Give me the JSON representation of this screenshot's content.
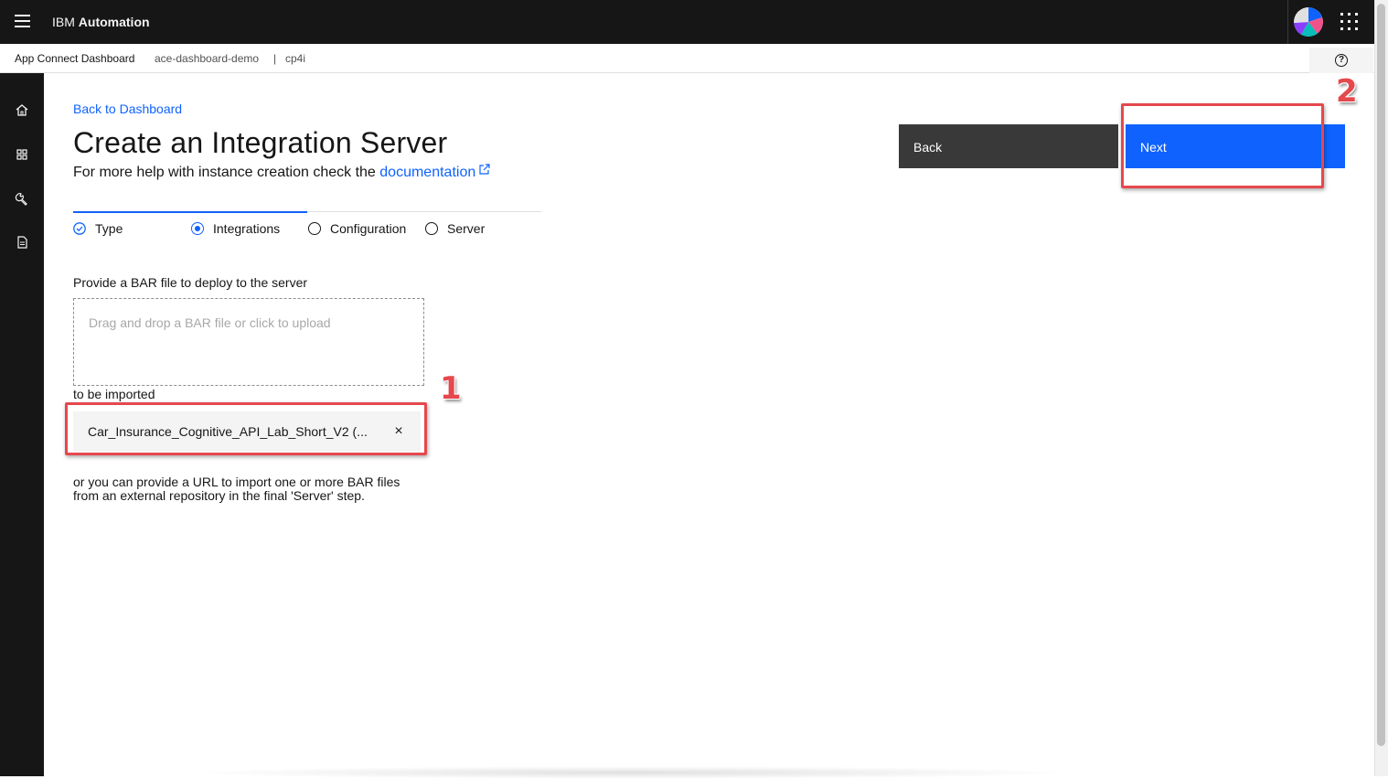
{
  "header": {
    "brand_prefix": "IBM",
    "brand_name": "Automation",
    "menu_icon": "hamburger-menu-icon",
    "avatar_icon": "user-avatar-icon",
    "switcher_icon": "app-switcher-icon"
  },
  "subheader": {
    "app_name": "App Connect Dashboard",
    "instance": "ace-dashboard-demo",
    "separator": "|",
    "namespace": "cp4i",
    "help_icon": "help-icon"
  },
  "sidenav": {
    "items": [
      {
        "icon": "home-icon"
      },
      {
        "icon": "dashboard-icon"
      },
      {
        "icon": "tools-icon"
      },
      {
        "icon": "document-icon"
      }
    ]
  },
  "page": {
    "back_link": "Back to Dashboard",
    "title": "Create an Integration Server",
    "subtitle_prefix": "For more help with instance creation check the",
    "doc_link": "documentation"
  },
  "actions": {
    "back_label": "Back",
    "next_label": "Next"
  },
  "steps": [
    {
      "label": "Type",
      "state": "complete"
    },
    {
      "label": "Integrations",
      "state": "current"
    },
    {
      "label": "Configuration",
      "state": "incomplete"
    },
    {
      "label": "Server",
      "state": "incomplete"
    }
  ],
  "upload": {
    "label": "Provide a BAR file to deploy to the server",
    "dropzone_text": "Drag and drop a BAR file or click to upload",
    "imported_label": "to be imported",
    "file_name": "Car_Insurance_Cognitive_API_Lab_Short_V2 (...",
    "remove_glyph": "×",
    "url_note_line1": "or you can provide a URL to import one or more BAR files",
    "url_note_line2": "from an external repository in the final 'Server' step."
  },
  "callouts": {
    "first": "1",
    "second": "2",
    "color": "#e5484d"
  },
  "colors": {
    "primary": "#0f62fe",
    "header_bg": "#161616",
    "secondary_btn": "#393939"
  }
}
